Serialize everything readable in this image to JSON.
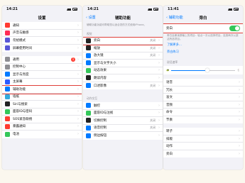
{
  "colors": {
    "accent": "#007aff",
    "toggle_on": "#34c759",
    "highlight": "#e0403a",
    "badge": "#ff3b30"
  },
  "screen1": {
    "time": "14:21",
    "title": "设置",
    "group1": [
      {
        "label": "通知",
        "icon": "notifications-icon",
        "color": "#ff3b30"
      },
      {
        "label": "声音与触感",
        "icon": "sounds-icon",
        "color": "#ff2d55"
      },
      {
        "label": "勿扰模式",
        "icon": "moon-icon",
        "color": "#5856d6"
      },
      {
        "label": "屏幕使用时间",
        "icon": "hourglass-icon",
        "color": "#5856d6"
      }
    ],
    "group2": [
      {
        "label": "通用",
        "icon": "gear-icon",
        "color": "#8e8e93",
        "badge": "1"
      },
      {
        "label": "控制中心",
        "icon": "control-center-icon",
        "color": "#8e8e93"
      },
      {
        "label": "显示与亮度",
        "icon": "brightness-icon",
        "color": "#007aff"
      },
      {
        "label": "主屏幕",
        "icon": "home-screen-icon",
        "color": "#2c5cff"
      },
      {
        "label": "辅助功能",
        "icon": "accessibility-icon",
        "color": "#007aff"
      },
      {
        "label": "墙纸",
        "icon": "wallpaper-icon",
        "color": "#34aadc"
      },
      {
        "label": "Siri与搜索",
        "icon": "siri-icon",
        "color": "#222222"
      },
      {
        "label": "面容ID与密码",
        "icon": "face-id-icon",
        "color": "#34c759"
      },
      {
        "label": "SOS紧急联络",
        "icon": "sos-icon",
        "color": "#ff3b30"
      },
      {
        "label": "暴露通知",
        "icon": "exposure-icon",
        "color": "#ff3b30"
      },
      {
        "label": "电池",
        "icon": "battery-icon",
        "color": "#34c759"
      }
    ]
  },
  "screen2": {
    "time": "14:21",
    "back": "设置",
    "title": "辅助功能",
    "intro": "辅助功能功能可帮助您以适合您的方式使用iPhone。",
    "section_vision": "视觉",
    "vision": [
      {
        "label": "旁白",
        "value": "关闭",
        "icon": "voiceover-icon",
        "color": "#222222"
      },
      {
        "label": "缩放",
        "value": "关闭",
        "icon": "zoom-icon",
        "color": "#222222"
      },
      {
        "label": "放大镜",
        "value": "关闭",
        "icon": "magnifier-icon",
        "color": "#007aff"
      },
      {
        "label": "显示与文字大小",
        "value": "",
        "icon": "text-size-icon",
        "color": "#007aff"
      },
      {
        "label": "动态效果",
        "value": "",
        "icon": "motion-icon",
        "color": "#34c759"
      },
      {
        "label": "朗读内容",
        "value": "",
        "icon": "speech-icon",
        "color": "#222222"
      },
      {
        "label": "口述影像",
        "value": "关闭",
        "icon": "audio-description-icon",
        "color": "#007aff"
      }
    ],
    "section_physical": "动作交互",
    "physical": [
      {
        "label": "触控",
        "icon": "touch-icon",
        "color": "#007aff"
      },
      {
        "label": "面容ID与注视",
        "icon": "face-id-icon",
        "color": "#34c759"
      },
      {
        "label": "切换控制",
        "value": "关闭",
        "icon": "switch-control-icon",
        "color": "#222222"
      },
      {
        "label": "语音控制",
        "value": "关闭",
        "icon": "voice-control-icon",
        "color": "#007aff"
      },
      {
        "label": "侧边按钮",
        "icon": "side-button-icon",
        "color": "#007aff"
      }
    ]
  },
  "screen3": {
    "time": "11:41",
    "back": "辅助功能",
    "title": "旁白",
    "toggle_label": "旁白",
    "toggle_on": true,
    "note": "旁白会朗读屏幕上的项目：轻点一次以选择项目。连按两次以激活所选项目。",
    "learn_more": "了解更多…",
    "practice": "旁白练习",
    "section_rate": "说话速率",
    "rows_a": [
      "语音",
      "冗长",
      "盲文",
      "音频",
      "命令",
      "节奏"
    ],
    "section_b": "",
    "rows_b": [
      "转子",
      "排版",
      "动作",
      "旁白"
    ]
  }
}
